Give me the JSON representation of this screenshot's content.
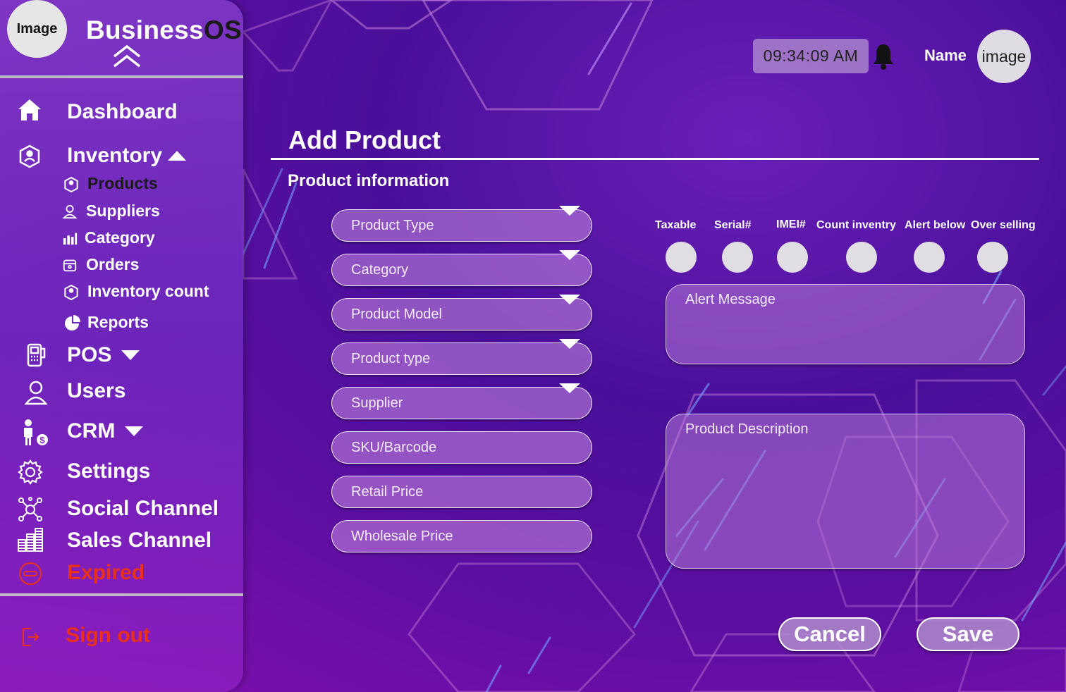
{
  "app": {
    "logo_text": "Image",
    "brand_prefix": "Business",
    "brand_suffix": "OS"
  },
  "header": {
    "time": "09:34:09 AM",
    "user_name": "Name",
    "avatar_text": "image"
  },
  "sidebar": {
    "dashboard": "Dashboard",
    "inventory": "Inventory",
    "inventory_sub": {
      "products": "Products",
      "suppliers": "Suppliers",
      "category": "Category",
      "orders": "Orders",
      "inventory_count": "Inventory count",
      "reports": "Reports"
    },
    "pos": "POS",
    "users": "Users",
    "crm": "CRM",
    "settings": "Settings",
    "social_channel": "Social Channel",
    "sales_channel": "Sales Channel",
    "expired": "Expired",
    "sign_out": "Sign out"
  },
  "main": {
    "title": "Add Product",
    "section": "Product information",
    "fields": {
      "product_type": "Product Type",
      "category": "Category",
      "product_model": "Product Model",
      "product_type2": "Product type",
      "supplier": "Supplier",
      "sku": "SKU/Barcode",
      "retail_price": "Retail Price",
      "wholesale_price": "Wholesale Price"
    },
    "toggles": {
      "taxable": "Taxable",
      "serial": "Serial#",
      "imei": "IMEI#",
      "count_inventory": "Count inventry",
      "alert_below": "Alert below",
      "over_selling": "Over selling"
    },
    "alert_message": "Alert Message",
    "product_description": "Product Description",
    "cancel": "Cancel",
    "save": "Save"
  },
  "colors": {
    "expired": "#e8301a",
    "active_nav": "#1a1a1a"
  }
}
